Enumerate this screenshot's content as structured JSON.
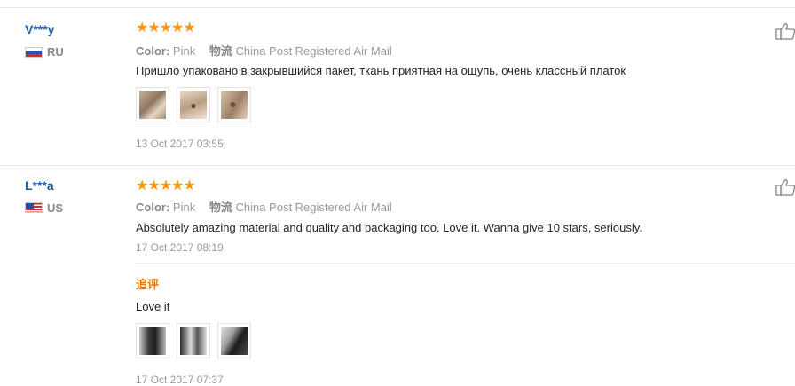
{
  "reviews": [
    {
      "user": "V***y",
      "country": "RU",
      "stars": "★★★★★",
      "color_label": "Color:",
      "color_value": "Pink",
      "logistics_label": "物流",
      "logistics_value": "China Post Registered Air Mail",
      "text": "Пришло упаковано в закрывшийся пакет, ткань приятная на ощупь, очень классный платок",
      "photos": [
        "photo-1",
        "photo-2",
        "photo-3"
      ],
      "date": "13 Oct 2017 03:55"
    },
    {
      "user": "L***a",
      "country": "US",
      "stars": "★★★★★",
      "color_label": "Color:",
      "color_value": "Pink",
      "logistics_label": "物流",
      "logistics_value": "China Post Registered Air Mail",
      "text": "Absolutely amazing material and quality and packaging too. Love it. Wanna give 10 stars, seriously.",
      "date": "17 Oct 2017 08:19",
      "additional": {
        "label": "追评",
        "text": "Love it",
        "photos": [
          "photo-1",
          "photo-2",
          "photo-3"
        ],
        "date": "17 Oct 2017 07:37"
      }
    }
  ],
  "colors": {
    "star": "#ff9800",
    "username": "#1a5fa8",
    "followup": "#e07800"
  },
  "icons": {
    "helpful": "thumbs-up-icon"
  }
}
